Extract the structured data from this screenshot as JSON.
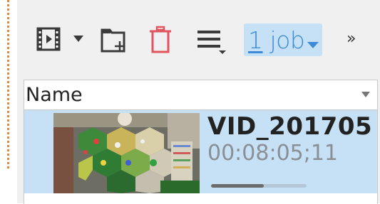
{
  "toolbar": {
    "items": [
      {
        "icon": "film-icon"
      },
      {
        "icon": "chevron-down-icon"
      },
      {
        "icon": "add-folder-icon"
      },
      {
        "icon": "trash-icon",
        "color": "#e05560"
      },
      {
        "icon": "hamburger-menu-icon"
      }
    ],
    "jobs_count": "1",
    "jobs_word": " job",
    "overflow": "»",
    "accent": "#3d8bd6",
    "job_bg": "#c6e1f5"
  },
  "list": {
    "column_header": "Name",
    "items": [
      {
        "name": "VID_201705",
        "duration": "00:08:05;11",
        "progress": 0.55,
        "selected": true
      }
    ]
  }
}
